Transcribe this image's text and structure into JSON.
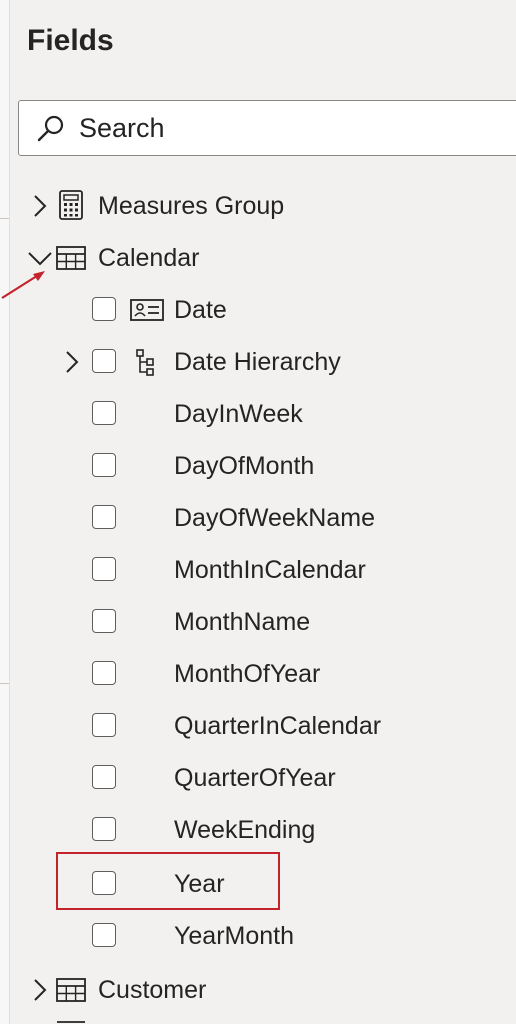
{
  "pane": {
    "title": "Fields"
  },
  "search": {
    "placeholder": "Search",
    "value": ""
  },
  "tables": [
    {
      "label": "Measures Group",
      "expanded": false,
      "icon": "calculator-icon"
    },
    {
      "label": "Calendar",
      "expanded": true,
      "icon": "table-icon"
    },
    {
      "label": "Customer",
      "expanded": false,
      "icon": "table-icon"
    }
  ],
  "calendar_fields": [
    {
      "label": "Date",
      "checked": false,
      "icon": "date-field-icon"
    },
    {
      "label": "Date Hierarchy",
      "checked": false,
      "icon": "hierarchy-icon",
      "expandable": true
    },
    {
      "label": "DayInWeek",
      "checked": false
    },
    {
      "label": "DayOfMonth",
      "checked": false
    },
    {
      "label": "DayOfWeekName",
      "checked": false
    },
    {
      "label": "MonthInCalendar",
      "checked": false
    },
    {
      "label": "MonthName",
      "checked": false
    },
    {
      "label": "MonthOfYear",
      "checked": false
    },
    {
      "label": "QuarterInCalendar",
      "checked": false
    },
    {
      "label": "QuarterOfYear",
      "checked": false
    },
    {
      "label": "WeekEnding",
      "checked": false
    },
    {
      "label": "Year",
      "checked": false,
      "highlighted": true
    },
    {
      "label": "YearMonth",
      "checked": false
    }
  ],
  "colors": {
    "annotation": "#c4232b",
    "text": "#252423",
    "pane_bg": "#f2f1f0"
  }
}
